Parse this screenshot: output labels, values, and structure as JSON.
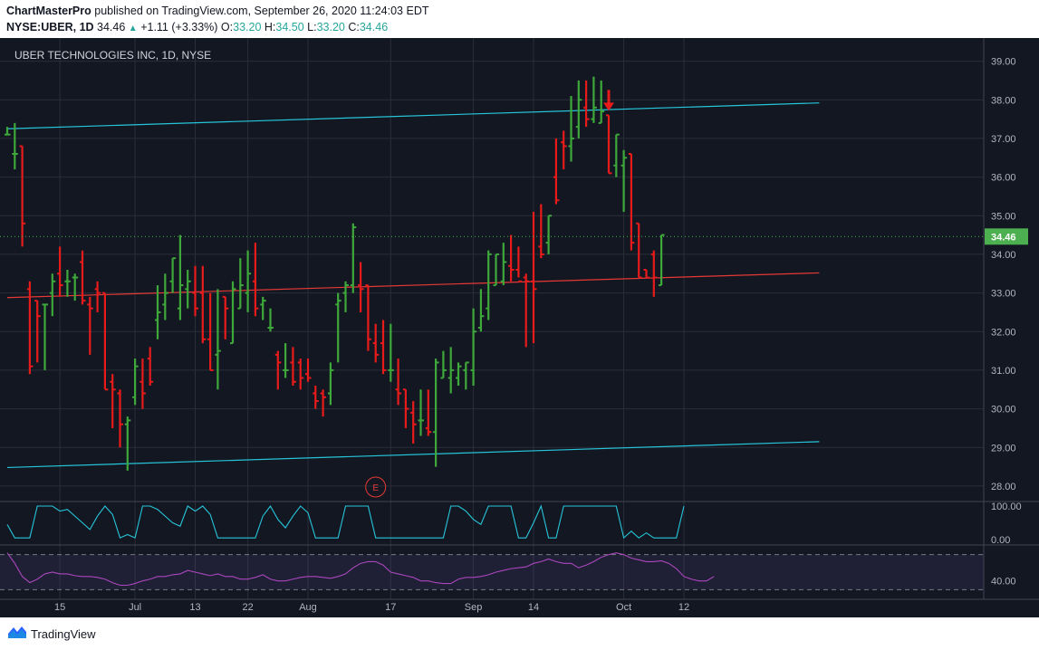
{
  "header": {
    "author": "ChartMasterPro",
    "published_text": "published on TradingView.com, September 26, 2020 11:24:03 EDT",
    "symbol": "NYSE:UBER, 1D",
    "last": "34.46",
    "change": "+1.11 (+3.33%)",
    "o_label": "O:",
    "o_value": "33.20",
    "h_label": "H:",
    "h_value": "34.50",
    "l_label": "L:",
    "l_value": "33.20",
    "c_label": "C:",
    "c_value": "34.46"
  },
  "footer": {
    "brand": "TradingView"
  },
  "chart_data": {
    "type": "bar",
    "title": "UBER TECHNOLOGIES INC, 1D, NYSE",
    "price_axis": {
      "ticks": [
        "39.00",
        "38.00",
        "37.00",
        "36.00",
        "35.00",
        "34.00",
        "33.00",
        "32.00",
        "31.00",
        "30.00",
        "29.00",
        "28.00"
      ],
      "range": [
        27.6,
        39.6
      ]
    },
    "last_price": 34.46,
    "last_price_label": "34.46",
    "x_ticks": [
      {
        "label": "15",
        "index": 7
      },
      {
        "label": "Jul",
        "index": 17
      },
      {
        "label": "13",
        "index": 25
      },
      {
        "label": "22",
        "index": 32
      },
      {
        "label": "Aug",
        "index": 40
      },
      {
        "label": "17",
        "index": 51
      },
      {
        "label": "Sep",
        "index": 62
      },
      {
        "label": "14",
        "index": 70
      },
      {
        "label": "Oct",
        "index": 82
      },
      {
        "label": "12",
        "index": 90
      }
    ],
    "ohlc": [
      [
        37.1,
        37.3,
        37.1,
        37.1
      ],
      [
        36.6,
        37.4,
        36.2,
        36.6
      ],
      [
        36.8,
        36.8,
        34.2,
        34.8
      ],
      [
        33.1,
        33.3,
        30.9,
        31.1
      ],
      [
        32.8,
        32.8,
        31.2,
        32.4
      ],
      [
        32.7,
        32.7,
        31.0,
        32.7
      ],
      [
        33.0,
        33.5,
        32.4,
        33.3
      ],
      [
        33.5,
        34.2,
        32.9,
        33.2
      ],
      [
        33.3,
        33.6,
        32.9,
        33.3
      ],
      [
        33.4,
        33.5,
        32.8,
        33.4
      ],
      [
        33.8,
        34.1,
        32.7,
        32.8
      ],
      [
        32.7,
        32.9,
        31.4,
        32.6
      ],
      [
        33.1,
        33.3,
        32.5,
        33.0
      ],
      [
        33.0,
        33.0,
        30.5,
        30.5
      ],
      [
        30.7,
        30.9,
        29.5,
        30.5
      ],
      [
        30.4,
        30.5,
        29.0,
        29.6
      ],
      [
        29.6,
        29.8,
        28.4,
        29.7
      ],
      [
        30.3,
        31.3,
        30.1,
        31.1
      ],
      [
        30.7,
        31.3,
        30.0,
        30.4
      ],
      [
        31.3,
        31.6,
        30.6,
        30.7
      ],
      [
        32.3,
        33.2,
        31.8,
        32.5
      ],
      [
        32.7,
        33.5,
        32.3,
        33.0
      ],
      [
        33.3,
        33.9,
        33.0,
        33.9
      ],
      [
        32.6,
        34.5,
        32.3,
        33.2
      ],
      [
        33.1,
        33.6,
        32.6,
        33.3
      ],
      [
        33.0,
        33.7,
        32.4,
        32.6
      ],
      [
        33.0,
        33.7,
        31.7,
        31.8
      ],
      [
        31.8,
        33.0,
        31.0,
        31.0
      ],
      [
        31.4,
        33.1,
        30.5,
        31.5
      ],
      [
        32.9,
        32.9,
        31.8,
        32.6
      ],
      [
        31.7,
        33.3,
        31.7,
        33.1
      ],
      [
        32.6,
        33.9,
        32.6,
        33.2
      ],
      [
        33.0,
        34.1,
        32.5,
        33.5
      ],
      [
        33.3,
        34.3,
        32.4,
        32.6
      ],
      [
        32.7,
        32.9,
        32.3,
        32.8
      ],
      [
        32.1,
        32.6,
        32.0,
        32.1
      ],
      [
        31.4,
        31.5,
        30.5,
        31.2
      ],
      [
        31.0,
        31.7,
        30.8,
        31.0
      ],
      [
        31.2,
        31.6,
        30.6,
        30.7
      ],
      [
        31.2,
        31.3,
        30.5,
        30.8
      ],
      [
        30.9,
        31.3,
        30.7,
        30.8
      ],
      [
        30.4,
        30.6,
        30.0,
        30.2
      ],
      [
        30.4,
        30.5,
        29.8,
        30.3
      ],
      [
        30.4,
        31.2,
        30.1,
        31.0
      ],
      [
        32.7,
        33.0,
        31.2,
        32.8
      ],
      [
        33.0,
        33.3,
        32.5,
        33.2
      ],
      [
        33.2,
        34.8,
        33.0,
        34.7
      ],
      [
        33.2,
        33.8,
        32.5,
        33.1
      ],
      [
        33.2,
        33.2,
        31.5,
        31.8
      ],
      [
        31.7,
        32.2,
        31.2,
        31.4
      ],
      [
        31.7,
        32.3,
        30.9,
        31.0
      ],
      [
        31.0,
        32.2,
        30.7,
        31.0
      ],
      [
        30.5,
        31.3,
        30.1,
        30.4
      ],
      [
        30.5,
        30.5,
        29.5,
        30.0
      ],
      [
        29.9,
        30.2,
        29.1,
        29.6
      ],
      [
        29.7,
        30.5,
        29.3,
        29.7
      ],
      [
        29.5,
        30.5,
        29.3,
        29.4
      ],
      [
        29.4,
        31.3,
        28.5,
        31.2
      ],
      [
        30.8,
        31.5,
        30.8,
        31.0
      ],
      [
        30.8,
        31.6,
        30.4,
        31.0
      ],
      [
        30.8,
        31.2,
        30.6,
        31.1
      ],
      [
        31.0,
        31.2,
        30.5,
        31.2
      ],
      [
        31.0,
        32.6,
        30.6,
        32.0
      ],
      [
        32.1,
        33.1,
        32.0,
        32.4
      ],
      [
        32.6,
        34.1,
        32.3,
        34.0
      ],
      [
        33.2,
        34.0,
        33.2,
        34.0
      ],
      [
        33.3,
        34.3,
        33.2,
        33.8
      ],
      [
        33.7,
        34.5,
        33.3,
        33.6
      ],
      [
        33.6,
        34.2,
        33.4,
        33.3
      ],
      [
        33.4,
        33.5,
        31.6,
        33.3
      ],
      [
        33.3,
        35.1,
        31.7,
        33.1
      ],
      [
        34.2,
        35.3,
        33.9,
        34.0
      ],
      [
        34.3,
        35.0,
        34.0,
        35.0
      ],
      [
        36.0,
        37.0,
        35.3,
        35.4
      ],
      [
        36.9,
        37.2,
        36.2,
        36.8
      ],
      [
        36.8,
        38.1,
        36.4,
        37.0
      ],
      [
        37.3,
        38.5,
        37.0,
        38.0
      ],
      [
        37.8,
        38.5,
        37.3,
        37.5
      ],
      [
        37.5,
        38.6,
        37.4,
        37.8
      ],
      [
        37.4,
        38.5,
        37.4,
        37.7
      ],
      [
        37.6,
        37.6,
        36.1,
        36.1
      ],
      [
        36.3,
        37.1,
        36.0,
        37.1
      ],
      [
        36.3,
        36.7,
        35.1,
        36.5
      ],
      [
        36.6,
        36.6,
        34.1,
        34.3
      ],
      [
        34.8,
        34.8,
        33.4,
        33.4
      ],
      [
        33.6,
        33.6,
        33.4,
        33.4
      ],
      [
        34.0,
        34.1,
        32.9,
        33.4
      ],
      [
        33.2,
        34.5,
        33.2,
        34.5
      ]
    ],
    "arrow_index": 80,
    "earnings_marker": "E",
    "earnings_index": 49,
    "channel_lines": [
      {
        "name": "upper",
        "color": "#26c6da",
        "from": [
          0,
          37.25
        ],
        "to": [
          108,
          37.92
        ]
      },
      {
        "name": "lower",
        "color": "#26c6da",
        "from": [
          0,
          28.48
        ],
        "to": [
          108,
          29.15
        ]
      },
      {
        "name": "mid",
        "color": "#e53935",
        "from": [
          0,
          32.88
        ],
        "to": [
          108,
          33.52
        ]
      }
    ],
    "oscillator1": {
      "color": "#26c6da",
      "ticks": [
        "100.00",
        "0.00"
      ],
      "values": [
        45,
        5,
        5,
        5,
        100,
        100,
        100,
        85,
        90,
        70,
        50,
        30,
        70,
        100,
        75,
        5,
        15,
        5,
        100,
        100,
        90,
        70,
        50,
        40,
        100,
        85,
        100,
        75,
        5,
        5,
        5,
        5,
        5,
        5,
        70,
        100,
        60,
        35,
        70,
        100,
        80,
        5,
        5,
        5,
        5,
        100,
        100,
        100,
        100,
        5,
        5,
        5,
        5,
        5,
        5,
        5,
        5,
        5,
        5,
        100,
        100,
        85,
        60,
        45,
        100,
        100,
        100,
        100,
        5,
        5,
        50,
        100,
        5,
        5,
        100,
        100,
        100,
        100,
        100,
        100,
        100,
        100,
        5,
        25,
        5,
        20,
        5,
        5,
        5,
        5,
        100
      ]
    },
    "oscillator2": {
      "color": "#ab47bc",
      "tick": "40.00",
      "values": [
        72,
        60,
        45,
        38,
        42,
        48,
        50,
        48,
        48,
        46,
        45,
        45,
        44,
        42,
        38,
        35,
        35,
        37,
        40,
        42,
        45,
        45,
        47,
        48,
        52,
        50,
        48,
        46,
        48,
        45,
        45,
        42,
        42,
        44,
        47,
        42,
        40,
        40,
        42,
        44,
        45,
        45,
        44,
        43,
        45,
        48,
        55,
        60,
        62,
        62,
        58,
        50,
        48,
        46,
        44,
        40,
        40,
        38,
        37,
        37,
        42,
        44,
        44,
        45,
        47,
        50,
        52,
        54,
        55,
        56,
        60,
        62,
        65,
        62,
        60,
        60,
        55,
        58,
        62,
        67,
        70,
        72,
        70,
        66,
        64,
        62,
        62,
        63,
        60,
        54,
        45,
        42,
        40,
        40,
        45
      ]
    }
  }
}
